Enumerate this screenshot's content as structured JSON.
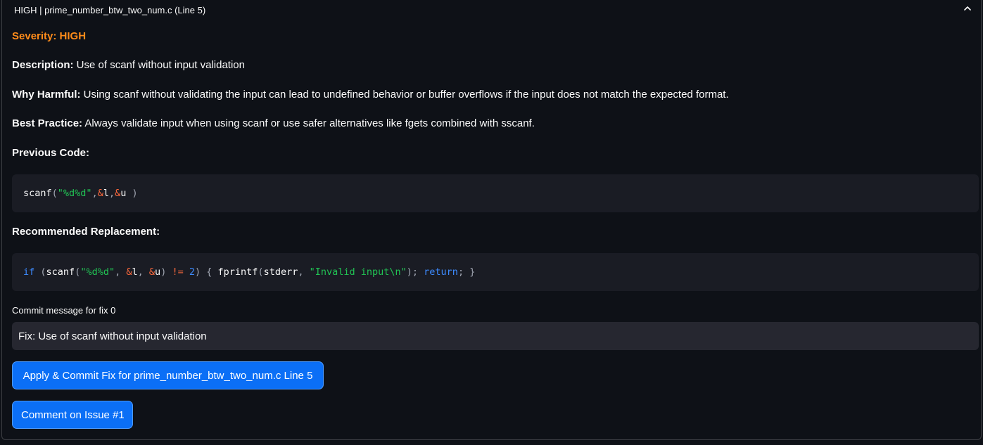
{
  "expander": {
    "title": "HIGH | prime_number_btw_two_num.c (Line 5)",
    "chevron_icon": "chevron-up-icon"
  },
  "issue": {
    "severity_text": "Severity: HIGH",
    "severity_color": "#ff8c1a",
    "description_label": "Description:",
    "description_value": " Use of scanf without input validation",
    "why_label": "Why Harmful:",
    "why_value": " Using scanf without validating the input can lead to undefined behavior or buffer overflows if the input does not match the expected format.",
    "best_label": "Best Practice:",
    "best_value": " Always validate input when using scanf or use safer alternatives like fgets combined with sscanf.",
    "previous_code_label": "Previous Code:",
    "recommended_label": "Recommended Replacement:"
  },
  "previous_code": {
    "t1": "scanf",
    "t2": "(",
    "t3": "\"%d%d\"",
    "t4": ",",
    "t5": "&",
    "t6": "l",
    "t7": ",",
    "t8": "&",
    "t9": "u ",
    "t10": ")"
  },
  "replacement_code": {
    "t1": "if",
    "t2": " (",
    "t3": "scanf",
    "t4": "(",
    "t5": "\"%d%d\"",
    "t6": ", ",
    "t7": "&",
    "t8": "l",
    "t9": ", ",
    "t10": "&",
    "t11": "u",
    "t12": ") ",
    "t13": "!=",
    "t14": " ",
    "t15": "2",
    "t16": ") { ",
    "t17": "fprintf",
    "t18": "(",
    "t19": "stderr",
    "t20": ", ",
    "t21": "\"Invalid input\\n\"",
    "t22": "); ",
    "t23": "return",
    "t24": "; }"
  },
  "commit": {
    "label": "Commit message for fix 0",
    "value": "Fix: Use of scanf without input validation"
  },
  "buttons": {
    "apply_label": "Apply & Commit Fix for prime_number_btw_two_num.c Line 5",
    "comment_label": "Comment on Issue #1"
  },
  "colors": {
    "background": "#0e1117",
    "code_background": "#1a1c24",
    "input_background": "#262730",
    "button_primary": "#0b6ff6",
    "string": "#21c354",
    "keyword": "#3d8bff",
    "operator": "#ff6a3d"
  }
}
